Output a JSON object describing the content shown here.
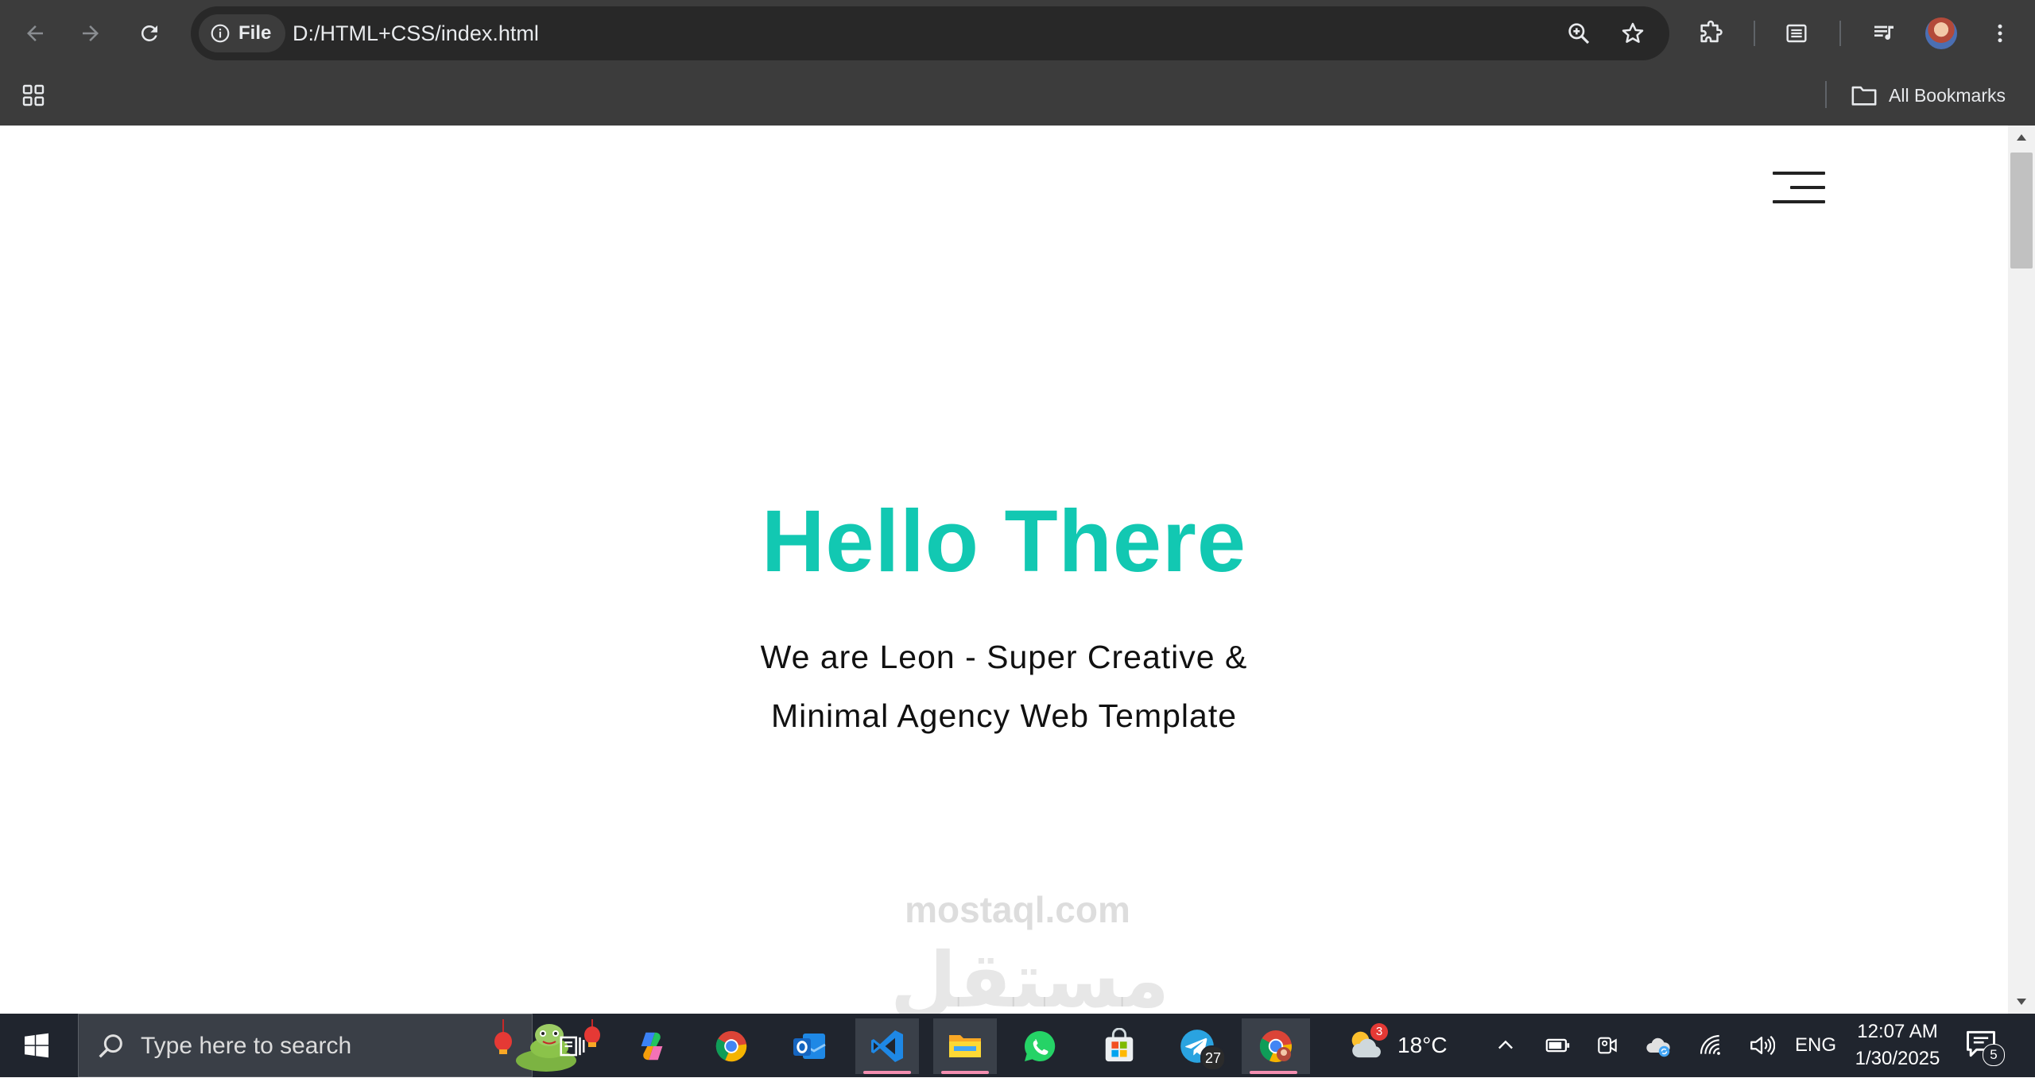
{
  "browser": {
    "site_chip_label": "File",
    "url": "D:/HTML+CSS/index.html",
    "bookmarks_label": "All Bookmarks"
  },
  "page": {
    "hero_title": "Hello There",
    "hero_sub_line1": "We are Leon - Super Creative &",
    "hero_sub_line2": "Minimal Agency Web Template",
    "accent_color": "#12c8b2",
    "watermark_arabic": "مستقل",
    "watermark_latin": "mostaql.com"
  },
  "taskbar": {
    "search_placeholder": "Type here to search",
    "telegram_badge": "27",
    "weather_badge": "3",
    "temperature": "18°C",
    "language": "ENG",
    "time": "12:07 AM",
    "date": "1/30/2025",
    "notification_count": "5"
  }
}
